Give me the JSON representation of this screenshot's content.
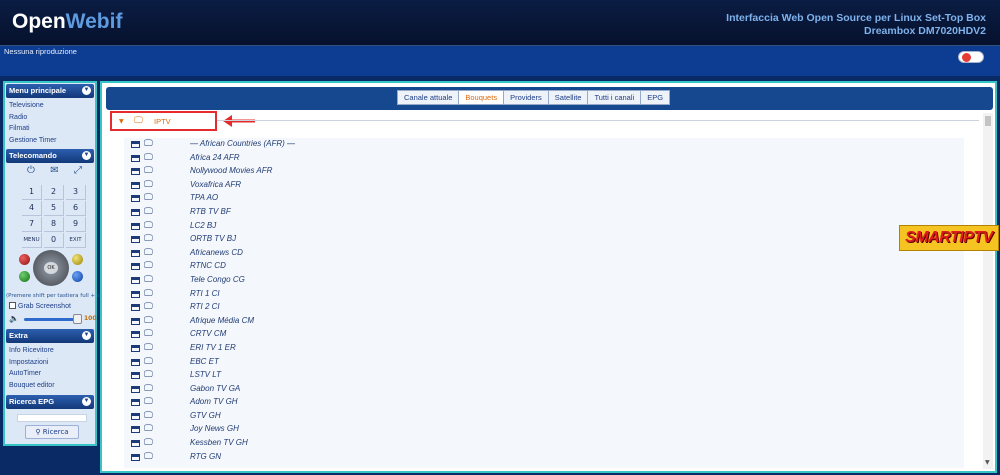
{
  "header": {
    "logo_part1": "Open",
    "logo_part2": "Webif",
    "tagline_line1": "Interfaccia Web Open Source per Linux Set-Top Box",
    "tagline_line2": "Dreambox DM7020HDV2"
  },
  "status": {
    "now_playing": "Nessuna riproduzione"
  },
  "sidebar": {
    "main_menu": {
      "title": "Menu principale",
      "items": [
        {
          "label": "Televisione"
        },
        {
          "label": "Radio"
        },
        {
          "label": "Filmati"
        },
        {
          "label": "Gestione Timer"
        }
      ]
    },
    "remote": {
      "title": "Telecomando",
      "keys": [
        "1",
        "2",
        "3",
        "4",
        "5",
        "6",
        "7",
        "8",
        "9",
        "MENU",
        "0",
        "EXIT"
      ],
      "ok_label": "OK",
      "note": "(Premere shift per tastiera full + shift)",
      "grab_label": "Grab Screenshot",
      "volume": 100,
      "volume_label": "100"
    },
    "extra": {
      "title": "Extra",
      "items": [
        {
          "label": "Info Ricevitore"
        },
        {
          "label": "Impostazioni"
        },
        {
          "label": "AutoTimer"
        },
        {
          "label": "Bouquet editor"
        }
      ]
    },
    "epg_search": {
      "title": "Ricerca EPG",
      "button_label": "Ricerca"
    }
  },
  "main": {
    "tabs": [
      {
        "label": "Canale attuale",
        "active": false
      },
      {
        "label": "Bouquets",
        "active": true
      },
      {
        "label": "Providers",
        "active": false
      },
      {
        "label": "Satellite",
        "active": false
      },
      {
        "label": "Tutti i canali",
        "active": false
      },
      {
        "label": "EPG",
        "active": false
      }
    ],
    "bouquet_name": "IPTV",
    "channels": [
      "— African Countries (AFR) —",
      "Africa 24 AFR",
      "Nollywood Movies AFR",
      "Voxafrica AFR",
      "TPA AO",
      "RTB TV BF",
      "LC2 BJ",
      "ORTB TV BJ",
      "Africanews CD",
      "RTNC CD",
      "Tele Congo CG",
      "RTI 1 CI",
      "RTI 2 CI",
      "Afrique Média CM",
      "CRTV CM",
      "ERI TV 1 ER",
      "EBC ET",
      "LSTV LT",
      "Gabon TV GA",
      "Adom TV GH",
      "GTV GH",
      "Joy News GH",
      "Kessben TV GH",
      "RTG GN"
    ]
  },
  "overlay": {
    "watermark": "SMARTIPTV"
  },
  "colors": {
    "accent_orange": "#e06b0a",
    "header_bg": "#06112c",
    "status_bar": "#0d3c93",
    "highlight_red": "#e52b2b"
  }
}
